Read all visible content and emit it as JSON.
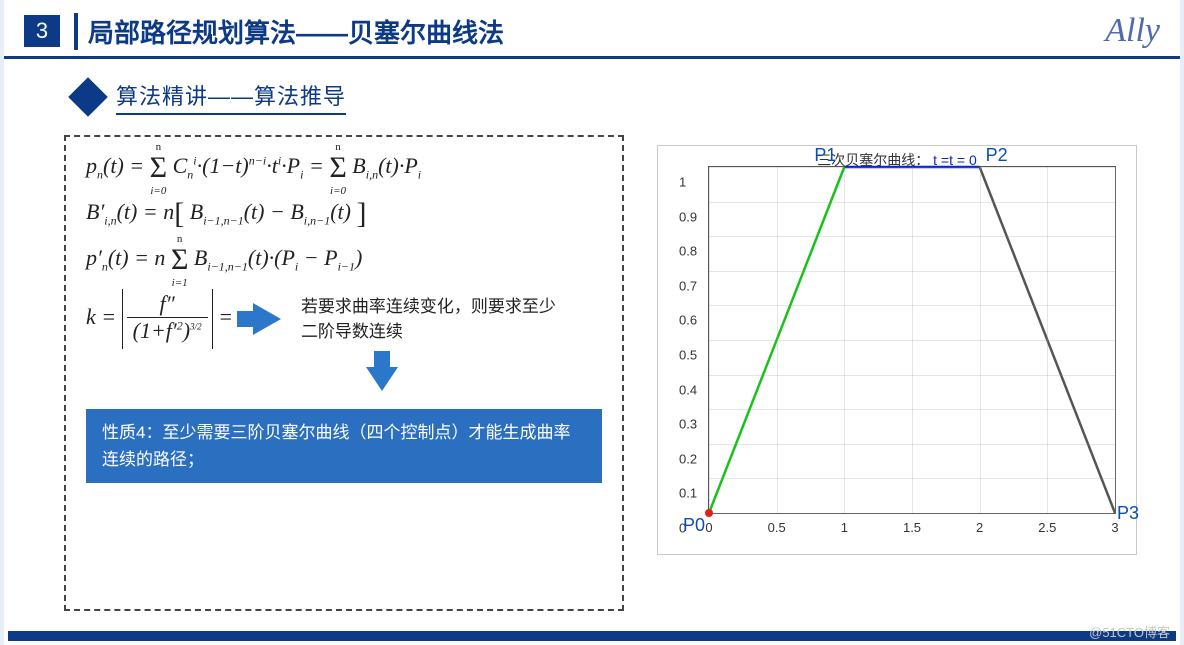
{
  "chapter": {
    "number": "3",
    "title": "局部路径规划算法——贝塞尔曲线法"
  },
  "brand": "Ally",
  "subtitle": "算法精讲——算法推导",
  "formulas": {
    "f1": "pₙ(t) = Σ Cₙⁱ·(1−t)ⁿ⁻ⁱ·tⁱ·Pᵢ = Σ Bᵢ,ₙ(t)·Pᵢ",
    "f2": "B′ᵢ,ₙ(t) = n[ Bᵢ₋₁,ₙ₋₁(t) − Bᵢ,ₙ₋₁(t) ]",
    "f3": "p′ₙ(t) = n Σ Bᵢ₋₁,ₙ₋₁(t)·(Pᵢ − Pᵢ₋₁)",
    "f4": "k = | f″ / (1 + f′²)^{3/2} | ="
  },
  "note": "若要求曲率连续变化，则要求至少二阶导数连续",
  "property": "性质4：至少需要三阶贝塞尔曲线（四个控制点）才能生成曲率连续的路径；",
  "watermark": "@51CTO博客",
  "chart_data": {
    "type": "line",
    "title": "三次贝塞尔曲线：",
    "param": "t = 0",
    "xlim": [
      0,
      3
    ],
    "ylim": [
      0,
      1
    ],
    "xticks": [
      0,
      0.5,
      1,
      1.5,
      2,
      2.5,
      3
    ],
    "yticks": [
      0,
      0.1,
      0.2,
      0.3,
      0.4,
      0.5,
      0.6,
      0.7,
      0.8,
      0.9,
      1
    ],
    "control_points": [
      {
        "name": "P0",
        "x": 0,
        "y": 0
      },
      {
        "name": "P1",
        "x": 1,
        "y": 1
      },
      {
        "name": "P2",
        "x": 2,
        "y": 1
      },
      {
        "name": "P3",
        "x": 3,
        "y": 0
      }
    ],
    "series": [
      {
        "name": "P0-P1",
        "color": "#17c21a",
        "points": [
          [
            0,
            0
          ],
          [
            1,
            1
          ]
        ]
      },
      {
        "name": "P1-P2",
        "color": "#0a25c9",
        "points": [
          [
            1,
            1
          ],
          [
            2,
            1
          ]
        ]
      },
      {
        "name": "P2-P3",
        "color": "#555555",
        "points": [
          [
            2,
            1
          ],
          [
            3,
            0
          ]
        ]
      }
    ],
    "curve_point": {
      "x": 0,
      "y": 0
    }
  }
}
